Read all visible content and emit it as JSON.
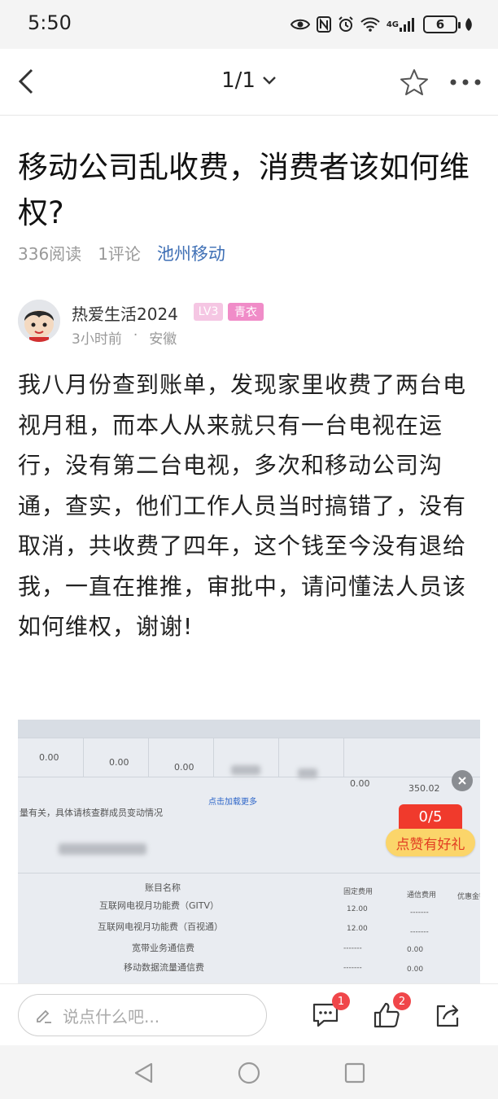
{
  "status_bar": {
    "time": "5:50",
    "network": "4G",
    "battery": "6"
  },
  "nav": {
    "page_indicator": "1/1"
  },
  "article": {
    "title": "移动公司乱收费，消费者该如何维权?",
    "reads": "336阅读",
    "comments": "1评论",
    "topic": "池州移动",
    "author": {
      "name": "热爱生活2024",
      "level": "LV3",
      "badge": "青衣",
      "time": "3小时前",
      "dot": "·",
      "location": "安徽"
    },
    "body": "我八月份查到账单，发现家里收费了两台电视月租，而本人从来就只有一台电视在运行，没有第二台电视，多次和移动公司沟通，查实，他们工作人员当时搞错了，没有取消，共收费了四年，这个钱至今没有退给我，一直在推推，审批中，请问懂法人员该如何维权，谢谢!"
  },
  "photo": {
    "row_vals": [
      "0.00",
      "0.00",
      "0.00",
      "0.00",
      "350.02"
    ],
    "load_more": "点击加载更多",
    "note": "量有关，具体请核查群成员变动情况",
    "col_name": "账目名称",
    "col_fixed": "固定费用",
    "col_comm": "通信费用",
    "col_discount": "优惠金额",
    "rows": [
      {
        "name": "互联网电视月功能费（GITV）",
        "fixed": "12.00",
        "comm": "-------"
      },
      {
        "name": "互联网电视月功能费（百视通）",
        "fixed": "12.00",
        "comm": "-------"
      },
      {
        "name": "宽带业务通信费",
        "fixed": "-------",
        "comm": "0.00"
      },
      {
        "name": "移动数据流量通信费",
        "fixed": "-------",
        "comm": "0.00"
      }
    ]
  },
  "gift": {
    "count": "0/5",
    "label": "点赞有好礼"
  },
  "actions": {
    "comment_placeholder": "说点什么吧...",
    "comment_count": "1",
    "like_count": "2"
  }
}
